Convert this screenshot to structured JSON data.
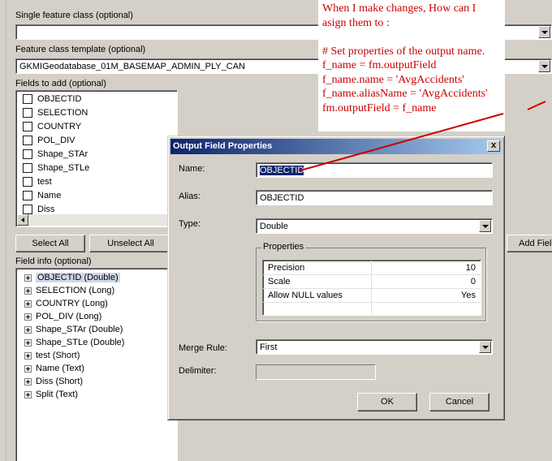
{
  "main": {
    "single_feature_class_label": "Single feature class (optional)",
    "single_feature_class_value": "",
    "template_label": "Feature class template (optional)",
    "template_value": "GKMIGeodatabase_01M_BASEMAP_ADMIN_PLY_CAN",
    "fields_to_add_label": "Fields to add (optional)",
    "fields": [
      {
        "label": "OBJECTID"
      },
      {
        "label": "SELECTION"
      },
      {
        "label": "COUNTRY"
      },
      {
        "label": "POL_DIV"
      },
      {
        "label": "Shape_STAr"
      },
      {
        "label": "Shape_STLe"
      },
      {
        "label": "test"
      },
      {
        "label": "Name"
      },
      {
        "label": "Diss"
      }
    ],
    "select_all_label": "Select All",
    "unselect_all_label": "Unselect All",
    "add_field_label": "Add Field",
    "field_info_label": "Field info (optional)",
    "field_info": [
      {
        "label": "OBJECTID (Double)"
      },
      {
        "label": "SELECTION (Long)"
      },
      {
        "label": "COUNTRY (Long)"
      },
      {
        "label": "POL_DIV (Long)"
      },
      {
        "label": "Shape_STAr (Double)"
      },
      {
        "label": "Shape_STLe (Double)"
      },
      {
        "label": "test (Short)"
      },
      {
        "label": "Name (Text)"
      },
      {
        "label": "Diss (Short)"
      },
      {
        "label": "Split (Text)"
      }
    ]
  },
  "dialog": {
    "title": "Output Field Properties",
    "close_label": "x",
    "name_label": "Name:",
    "name_value": "OBJECTID",
    "alias_label": "Alias:",
    "alias_value": "OBJECTID",
    "type_label": "Type:",
    "type_value": "Double",
    "properties_label": "Properties",
    "properties": [
      {
        "key": "Precision",
        "value": "10"
      },
      {
        "key": "Scale",
        "value": "0"
      },
      {
        "key": "Allow NULL values",
        "value": "Yes"
      }
    ],
    "merge_rule_label": "Merge Rule:",
    "merge_rule_value": "First",
    "delimiter_label": "Delimiter:",
    "delimiter_value": "",
    "ok_label": "OK",
    "cancel_label": "Cancel"
  },
  "annotation": {
    "lines": [
      "When I make changes, How can I",
      "asign them to :",
      "",
      "# Set properties of the output name.",
      "f_name = fm.outputField",
      "f_name.name = 'AvgAccidents'",
      "f_name.aliasName = 'AvgAccidents'",
      "fm.outputField = f_name"
    ],
    "color": "#cc0000"
  }
}
